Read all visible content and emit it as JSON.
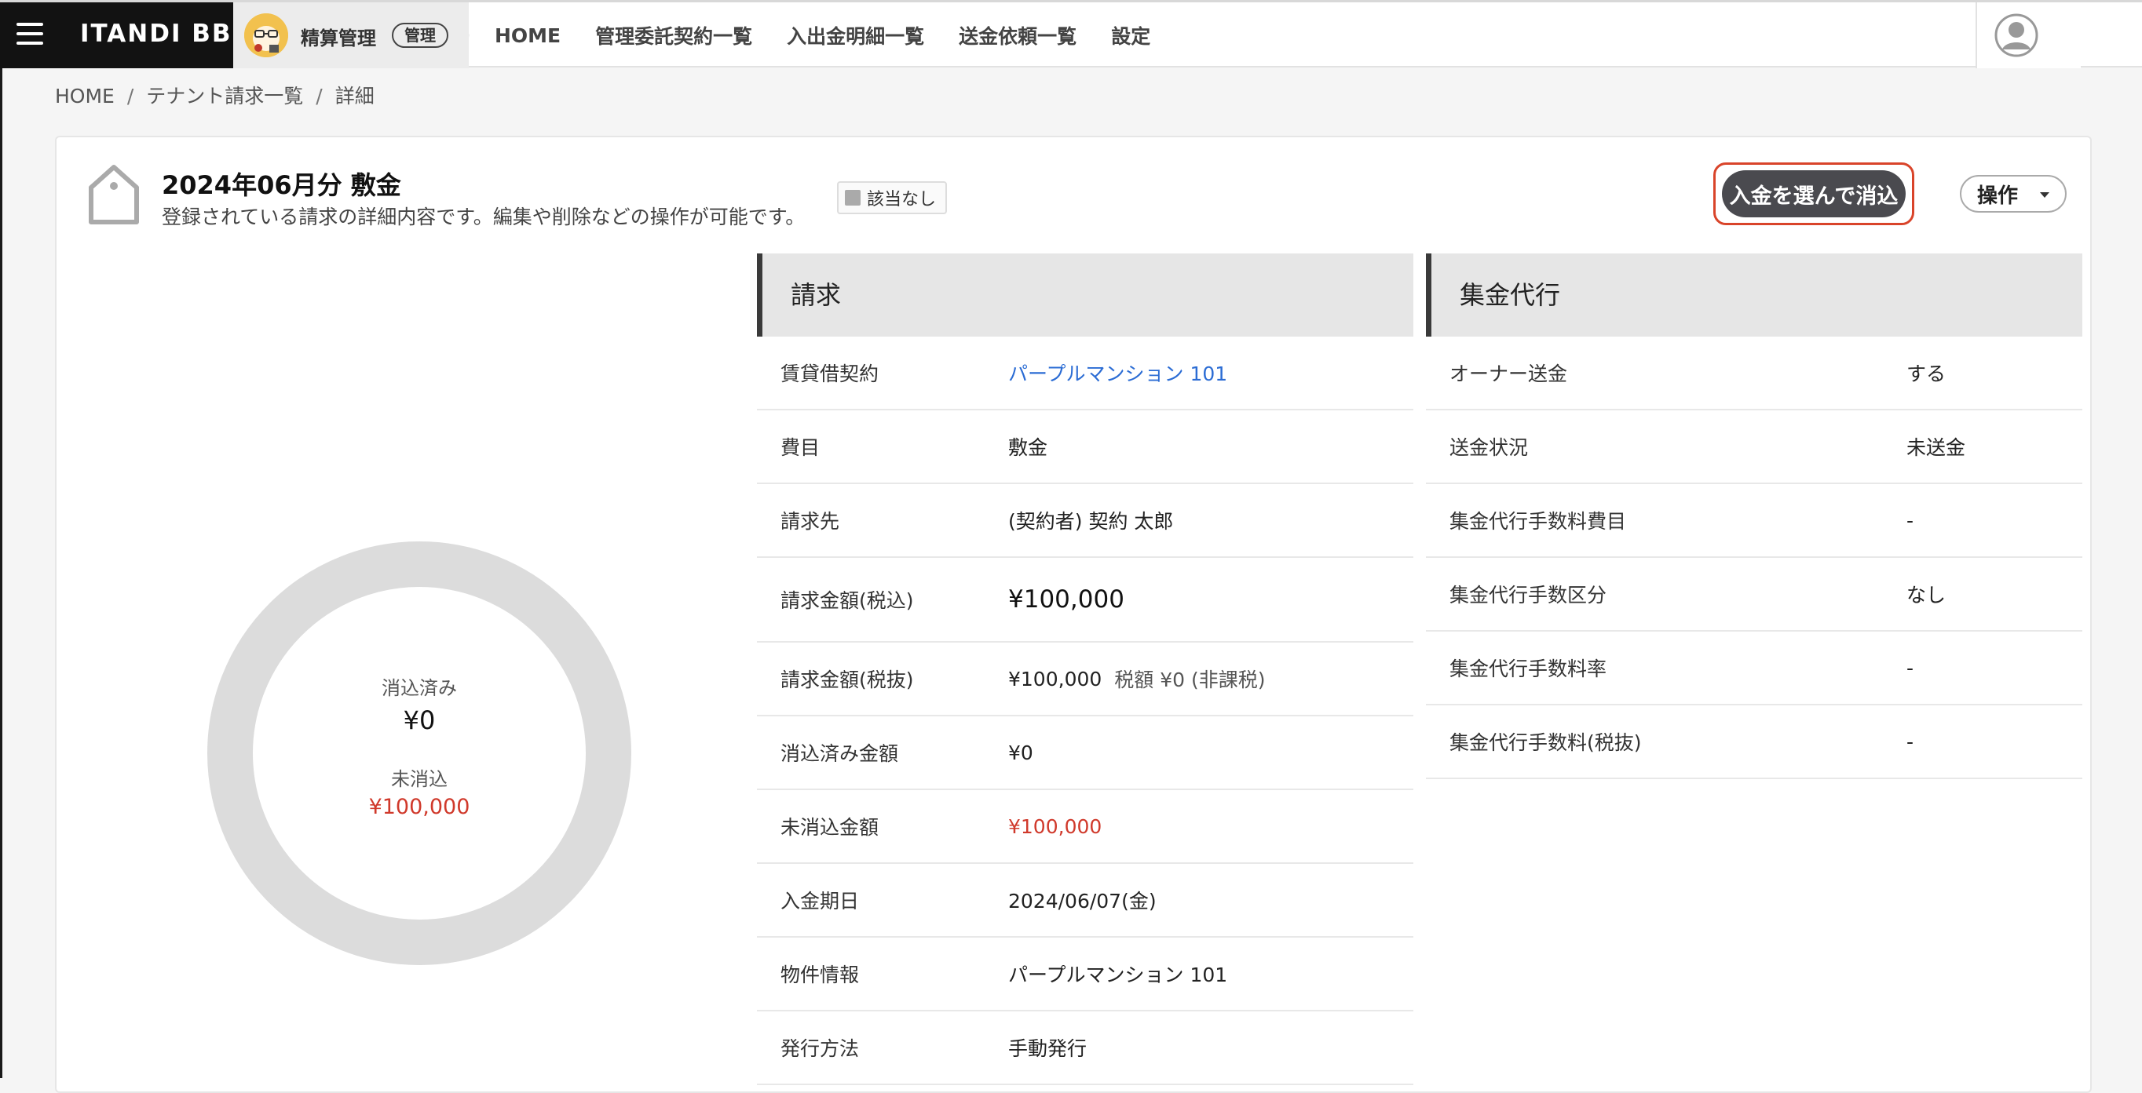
{
  "nav": {
    "logo": "ITANDI BB",
    "app_name": "精算管理",
    "app_badge": "管理",
    "links": [
      "HOME",
      "管理委託契約一覧",
      "入出金明細一覧",
      "送金依頼一覧",
      "設定"
    ]
  },
  "breadcrumb": [
    "HOME",
    "テナント請求一覧",
    "詳細"
  ],
  "header": {
    "title": "2024年06月分 敷金",
    "subtitle": "登録されている請求の詳細内容です。編集や削除などの操作が可能です。",
    "status_badge": "該当なし",
    "primary_button": "入金を選んで消込",
    "ops_button": "操作"
  },
  "summary": {
    "cleared_label": "消込済み",
    "cleared_value": "¥0",
    "uncleared_label": "未消込",
    "uncleared_value": "¥100,000",
    "cleared_fraction": 0
  },
  "billing": {
    "title": "請求",
    "rows": [
      {
        "label": "賃貸借契約",
        "value": "パープルマンション 101"
      },
      {
        "label": "費目",
        "value": "敷金"
      },
      {
        "label": "請求先",
        "value": "(契約者) 契約 太郎"
      },
      {
        "label": "請求金額(税込)",
        "value": "¥100,000"
      },
      {
        "label": "請求金額(税抜)",
        "value": "¥100,000",
        "extra": "税額 ¥0 (非課税)"
      },
      {
        "label": "消込済み金額",
        "value": "¥0"
      },
      {
        "label": "未消込金額",
        "value": "¥100,000"
      },
      {
        "label": "入金期日",
        "value": "2024/06/07(金)"
      },
      {
        "label": "物件情報",
        "value": "パープルマンション 101"
      },
      {
        "label": "発行方法",
        "value": "手動発行"
      }
    ]
  },
  "collection": {
    "title": "集金代行",
    "rows": [
      {
        "label": "オーナー送金",
        "value": "する"
      },
      {
        "label": "送金状況",
        "value": "未送金"
      },
      {
        "label": "集金代行手数料費目",
        "value": "-"
      },
      {
        "label": "集金代行手数区分",
        "value": "なし"
      },
      {
        "label": "集金代行手数料率",
        "value": "-"
      },
      {
        "label": "集金代行手数料(税抜)",
        "value": "-"
      }
    ]
  },
  "colors": {
    "accent_red": "#d0392b",
    "link_blue": "#2b6cd4",
    "button_dark": "#4a4a4f",
    "donut_gray": "#dcdcdc"
  }
}
